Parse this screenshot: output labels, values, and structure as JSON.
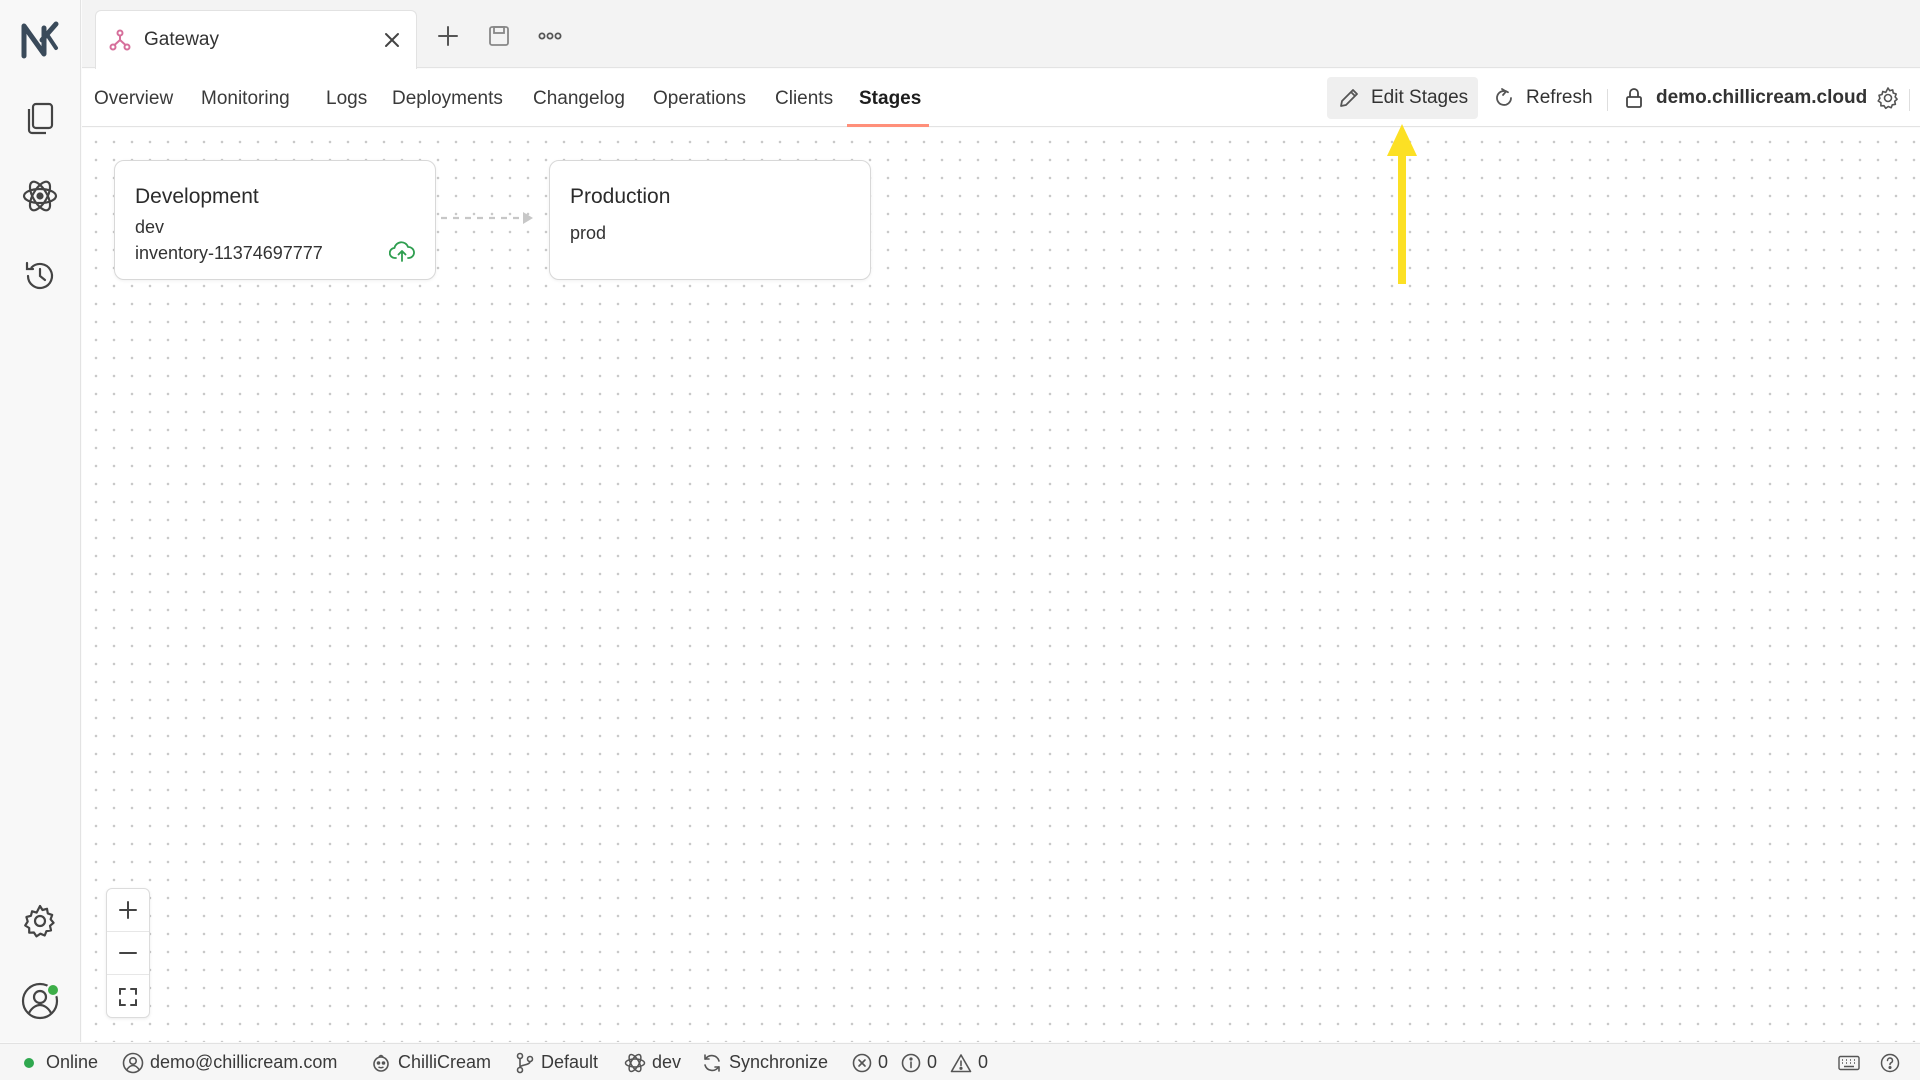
{
  "tab": {
    "title": "Gateway"
  },
  "nav": {
    "tabs": [
      "Overview",
      "Monitoring",
      "Logs",
      "Deployments",
      "Changelog",
      "Operations",
      "Clients",
      "Stages"
    ],
    "active_tab": "Stages"
  },
  "actions": {
    "edit_stages": "Edit Stages",
    "refresh": "Refresh",
    "host": "demo.chillicream.cloud"
  },
  "stages": [
    {
      "title": "Development",
      "name": "dev",
      "deployment": "inventory-11374697777"
    },
    {
      "title": "Production",
      "name": "prod"
    }
  ],
  "status": {
    "connection": "Online",
    "user": "demo@chillicream.com",
    "organization": "ChilliCream",
    "branch": "Default",
    "stage": "dev",
    "sync": "Synchronize",
    "errors": "0",
    "infos": "0",
    "warnings": "0"
  },
  "colors": {
    "accent": "#ff8f7a",
    "annotation_arrow": "#fce024",
    "online": "#2fa84f",
    "deploy_icon": "#2e9e4f",
    "tab_icon": "#d66f9b"
  }
}
